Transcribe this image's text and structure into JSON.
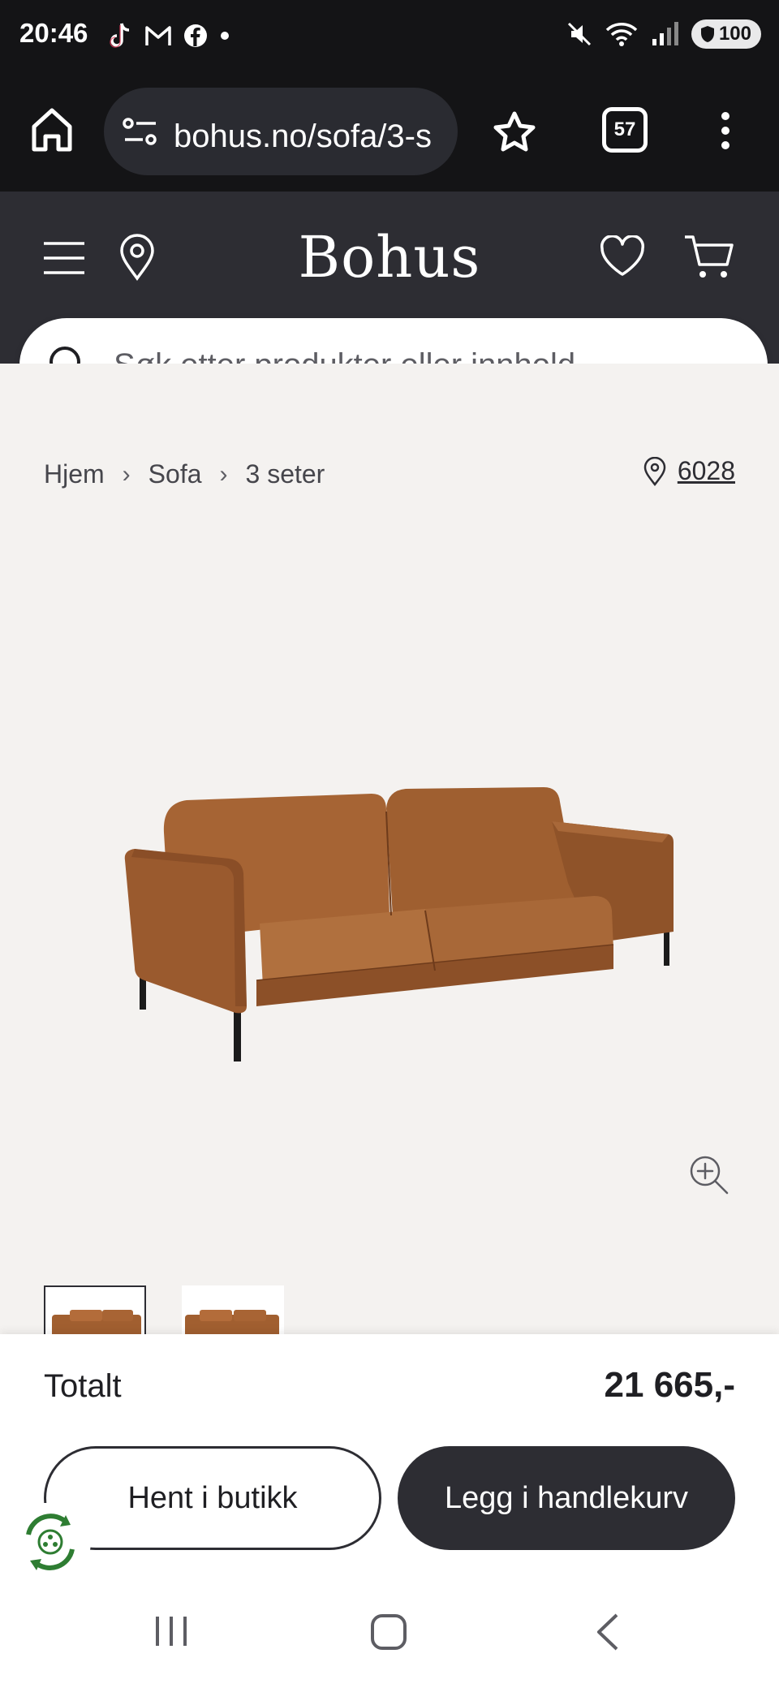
{
  "status_bar": {
    "time": "20:46",
    "battery": "100",
    "left_icons": [
      "tiktok-icon",
      "gmail-icon",
      "facebook-icon",
      "dot-icon"
    ],
    "right_icons": [
      "mute-icon",
      "wifi-icon",
      "signal-icon",
      "battery-icon"
    ]
  },
  "browser": {
    "url": "bohus.no/sofa/3-s",
    "tab_count": "57"
  },
  "header": {
    "logo": "Bohus",
    "search_placeholder": "Søk etter produkter eller innhold .."
  },
  "breadcrumb": {
    "items": [
      "Hjem",
      "Sofa",
      "3 seter"
    ],
    "store": "6028"
  },
  "product": {
    "image": "brown-leather-3-seat-sofa",
    "thumbnail_count": 2,
    "active_thumbnail": 1
  },
  "purchase": {
    "total_label": "Totalt",
    "total_value": "21 665,-",
    "pickup_button": "Hent i butikk",
    "cart_button": "Legg i handlekurv"
  },
  "colors": {
    "header_bg": "#2d2d33",
    "content_bg": "#f4f2f0",
    "sofa_brown": "#9a5a2e",
    "eco_green": "#2e7d32"
  }
}
